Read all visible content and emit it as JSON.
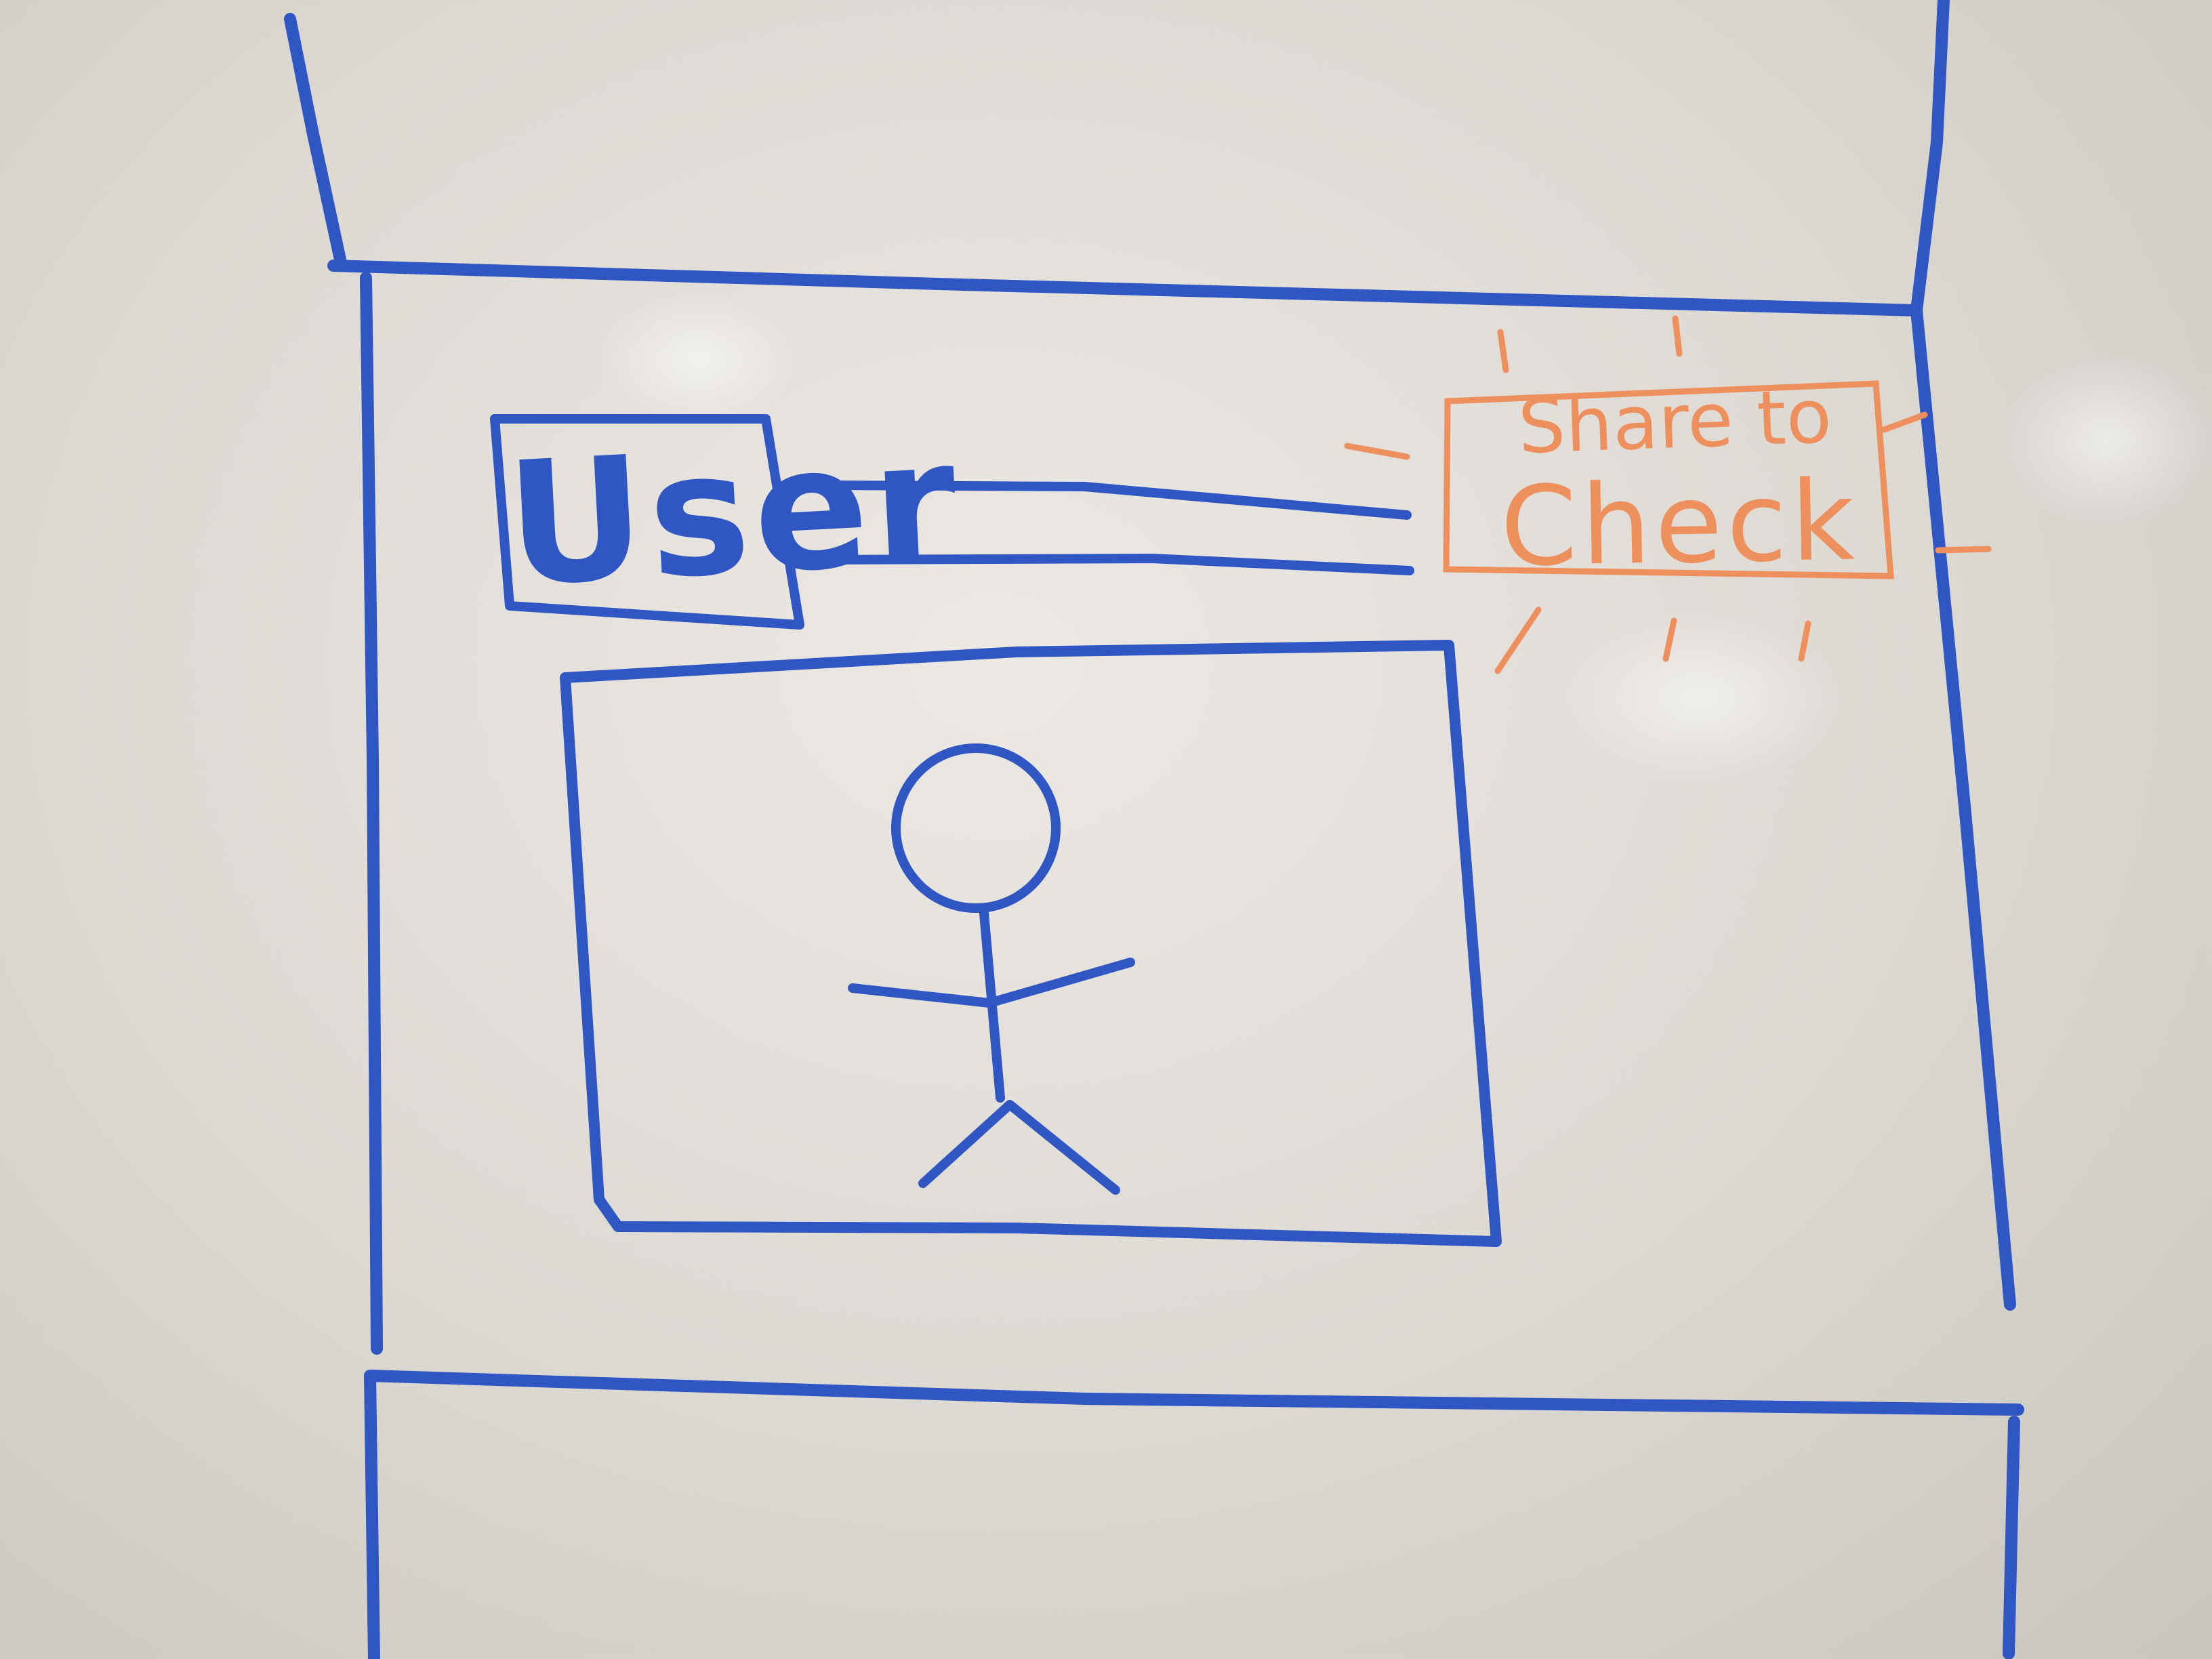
{
  "sketch": {
    "user_box": {
      "label": "User"
    },
    "share_button": {
      "line1": "Share to",
      "line2": "Check"
    }
  },
  "colors": {
    "marker_blue": "#2f56c2",
    "marker_orange": "#ee8f5e",
    "board": "#e4e1dc"
  }
}
